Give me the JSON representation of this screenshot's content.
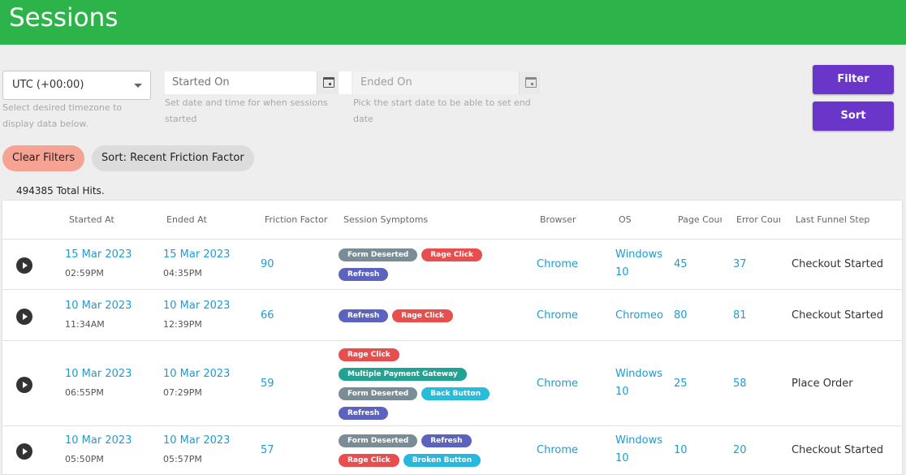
{
  "page": {
    "title": "Sessions"
  },
  "filters": {
    "timezone": {
      "value": "UTC (+00:00)",
      "help": "Select desired timezone to display data below."
    },
    "started_on": {
      "placeholder": "Started On",
      "help": "Set date and time for when sessions started"
    },
    "ended_on": {
      "placeholder": "Ended On",
      "help": "Pick the start date to be able to set end date"
    }
  },
  "actions": {
    "filter_label": "Filter",
    "sort_label": "Sort"
  },
  "chips": {
    "clear": "Clear Filters",
    "sort": "Sort: Recent Friction Factor"
  },
  "total_hits": "494385 Total Hits.",
  "table": {
    "columns": [
      "Started At",
      "Ended At",
      "Friction Factor",
      "Session Symptoms",
      "Browser",
      "OS",
      "Page Count",
      "Error Count",
      "Last Funnel Step"
    ],
    "rows": [
      {
        "start_date": "15 Mar 2023",
        "start_time": "02:59PM",
        "end_date": "15 Mar 2023",
        "end_time": "04:35PM",
        "friction": "90",
        "symptoms": [
          [
            "Form Deserted",
            "Rage Click"
          ],
          [
            "Refresh"
          ]
        ],
        "browser": "Chrome",
        "os_1": "Windows",
        "os_2": "10",
        "page_count": "45",
        "error_count": "37",
        "funnel": "Checkout Started"
      },
      {
        "start_date": "10 Mar 2023",
        "start_time": "11:34AM",
        "end_date": "10 Mar 2023",
        "end_time": "12:39PM",
        "friction": "66",
        "symptoms": [
          [
            "Refresh",
            "Rage Click"
          ]
        ],
        "browser": "Chrome",
        "os_1": "Chromeos",
        "os_2": "",
        "page_count": "80",
        "error_count": "81",
        "funnel": "Checkout Started"
      },
      {
        "start_date": "10 Mar 2023",
        "start_time": "06:55PM",
        "end_date": "10 Mar 2023",
        "end_time": "07:29PM",
        "friction": "59",
        "symptoms": [
          [
            "Rage Click"
          ],
          [
            "Multiple Payment Gateway"
          ],
          [
            "Form Deserted",
            "Back Button"
          ],
          [
            "Refresh"
          ]
        ],
        "browser": "Chrome",
        "os_1": "Windows",
        "os_2": "10",
        "page_count": "25",
        "error_count": "58",
        "funnel": "Place Order"
      },
      {
        "start_date": "10 Mar 2023",
        "start_time": "05:50PM",
        "end_date": "10 Mar 2023",
        "end_time": "05:57PM",
        "friction": "57",
        "symptoms": [
          [
            "Form Deserted",
            "Refresh"
          ],
          [
            "Rage Click",
            "Broken Button"
          ]
        ],
        "browser": "Chrome",
        "os_1": "Windows",
        "os_2": "10",
        "page_count": "10",
        "error_count": "20",
        "funnel": "Checkout Started"
      }
    ]
  },
  "symptom_colors": {
    "Form Deserted": "#7a8d96",
    "Rage Click": "#e94e4e",
    "Refresh": "#5b63be",
    "Multiple Payment Gateway": "#1fa393",
    "Back Button": "#27bcd7",
    "Broken Button": "#27b7df"
  },
  "colors": {
    "header": "#2cb34a",
    "accent": "#6a35c9",
    "link": "#1e9ccf",
    "clear_chip": "#f6a394"
  }
}
